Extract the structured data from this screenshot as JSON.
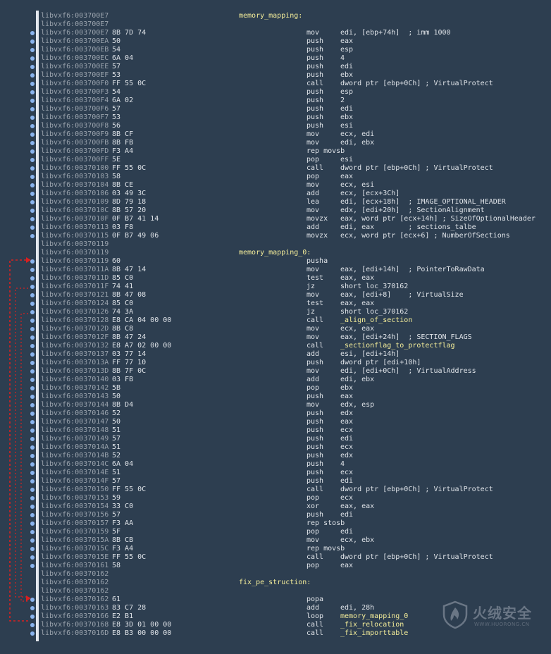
{
  "lines": [
    {
      "addr": "libvxf6:003700E7",
      "bytes": "",
      "label": "memory_mapping:",
      "mnem": "",
      "op": "",
      "dot": false
    },
    {
      "addr": "libvxf6:003700E7",
      "bytes": "",
      "label": "",
      "mnem": "",
      "op": "",
      "dot": false
    },
    {
      "addr": "libvxf6:003700E7",
      "bytes": "8B 7D 74",
      "label": "",
      "mnem": "mov",
      "op": "edi, [ebp+74h]  ; imm 1000",
      "dot": true
    },
    {
      "addr": "libvxf6:003700EA",
      "bytes": "50",
      "label": "",
      "mnem": "push",
      "op": "eax",
      "dot": true
    },
    {
      "addr": "libvxf6:003700EB",
      "bytes": "54",
      "label": "",
      "mnem": "push",
      "op": "esp",
      "dot": true
    },
    {
      "addr": "libvxf6:003700EC",
      "bytes": "6A 04",
      "label": "",
      "mnem": "push",
      "op": "4",
      "dot": true
    },
    {
      "addr": "libvxf6:003700EE",
      "bytes": "57",
      "label": "",
      "mnem": "push",
      "op": "edi",
      "dot": true
    },
    {
      "addr": "libvxf6:003700EF",
      "bytes": "53",
      "label": "",
      "mnem": "push",
      "op": "ebx",
      "dot": true
    },
    {
      "addr": "libvxf6:003700F0",
      "bytes": "FF 55 0C",
      "label": "",
      "mnem": "call",
      "op": "dword ptr [ebp+0Ch] ; VirtualProtect",
      "dot": true
    },
    {
      "addr": "libvxf6:003700F3",
      "bytes": "54",
      "label": "",
      "mnem": "push",
      "op": "esp",
      "dot": true
    },
    {
      "addr": "libvxf6:003700F4",
      "bytes": "6A 02",
      "label": "",
      "mnem": "push",
      "op": "2",
      "dot": true
    },
    {
      "addr": "libvxf6:003700F6",
      "bytes": "57",
      "label": "",
      "mnem": "push",
      "op": "edi",
      "dot": true
    },
    {
      "addr": "libvxf6:003700F7",
      "bytes": "53",
      "label": "",
      "mnem": "push",
      "op": "ebx",
      "dot": true
    },
    {
      "addr": "libvxf6:003700F8",
      "bytes": "56",
      "label": "",
      "mnem": "push",
      "op": "esi",
      "dot": true
    },
    {
      "addr": "libvxf6:003700F9",
      "bytes": "8B CF",
      "label": "",
      "mnem": "mov",
      "op": "ecx, edi",
      "dot": true
    },
    {
      "addr": "libvxf6:003700FB",
      "bytes": "8B FB",
      "label": "",
      "mnem": "mov",
      "op": "edi, ebx",
      "dot": true
    },
    {
      "addr": "libvxf6:003700FD",
      "bytes": "F3 A4",
      "label": "",
      "mnem": "rep movsb",
      "op": "",
      "dot": true
    },
    {
      "addr": "libvxf6:003700FF",
      "bytes": "5E",
      "label": "",
      "mnem": "pop",
      "op": "esi",
      "dot": true
    },
    {
      "addr": "libvxf6:00370100",
      "bytes": "FF 55 0C",
      "label": "",
      "mnem": "call",
      "op": "dword ptr [ebp+0Ch] ; VirtualProtect",
      "dot": true
    },
    {
      "addr": "libvxf6:00370103",
      "bytes": "58",
      "label": "",
      "mnem": "pop",
      "op": "eax",
      "dot": true
    },
    {
      "addr": "libvxf6:00370104",
      "bytes": "8B CE",
      "label": "",
      "mnem": "mov",
      "op": "ecx, esi",
      "dot": true
    },
    {
      "addr": "libvxf6:00370106",
      "bytes": "03 49 3C",
      "label": "",
      "mnem": "add",
      "op": "ecx, [ecx+3Ch]",
      "dot": true
    },
    {
      "addr": "libvxf6:00370109",
      "bytes": "8D 79 18",
      "label": "",
      "mnem": "lea",
      "op": "edi, [ecx+18h]  ; IMAGE_OPTIONAL_HEADER",
      "dot": true
    },
    {
      "addr": "libvxf6:0037010C",
      "bytes": "8B 57 20",
      "label": "",
      "mnem": "mov",
      "op": "edx, [edi+20h]  ; SectionAlignment",
      "dot": true
    },
    {
      "addr": "libvxf6:0037010F",
      "bytes": "0F B7 41 14",
      "label": "",
      "mnem": "movzx",
      "op": "eax, word ptr [ecx+14h] ; SizeOfOptionalHeader",
      "dot": true
    },
    {
      "addr": "libvxf6:00370113",
      "bytes": "03 F8",
      "label": "",
      "mnem": "add",
      "op": "edi, eax        ; sections_talbe",
      "dot": true
    },
    {
      "addr": "libvxf6:00370115",
      "bytes": "0F B7 49 06",
      "label": "",
      "mnem": "movzx",
      "op": "ecx, word ptr [ecx+6] ; NumberOfSections",
      "dot": true
    },
    {
      "addr": "libvxf6:00370119",
      "bytes": "",
      "label": "",
      "mnem": "",
      "op": "",
      "dot": false
    },
    {
      "addr": "libvxf6:00370119",
      "bytes": "",
      "label": "memory_mapping_0:",
      "mnem": "",
      "op": "",
      "dot": false
    },
    {
      "addr": "libvxf6:00370119",
      "bytes": "60",
      "label": "",
      "mnem": "pusha",
      "op": "",
      "dot": true
    },
    {
      "addr": "libvxf6:0037011A",
      "bytes": "8B 47 14",
      "label": "",
      "mnem": "mov",
      "op": "eax, [edi+14h]  ; PointerToRawData",
      "dot": true
    },
    {
      "addr": "libvxf6:0037011D",
      "bytes": "85 C0",
      "label": "",
      "mnem": "test",
      "op": "eax, eax",
      "dot": true
    },
    {
      "addr": "libvxf6:0037011F",
      "bytes": "74 41",
      "label": "",
      "mnem": "jz",
      "op": "short loc_370162",
      "dot": true
    },
    {
      "addr": "libvxf6:00370121",
      "bytes": "8B 47 08",
      "label": "",
      "mnem": "mov",
      "op": "eax, [edi+8]    ; VirtualSize",
      "dot": true
    },
    {
      "addr": "libvxf6:00370124",
      "bytes": "85 C0",
      "label": "",
      "mnem": "test",
      "op": "eax, eax",
      "dot": true
    },
    {
      "addr": "libvxf6:00370126",
      "bytes": "74 3A",
      "label": "",
      "mnem": "jz",
      "op": "short loc_370162",
      "dot": true
    },
    {
      "addr": "libvxf6:00370128",
      "bytes": "E8 CA 04 00 00",
      "label": "",
      "mnem": "call",
      "op": "_align_of_section",
      "ref": true,
      "dot": true
    },
    {
      "addr": "libvxf6:0037012D",
      "bytes": "8B C8",
      "label": "",
      "mnem": "mov",
      "op": "ecx, eax",
      "dot": true
    },
    {
      "addr": "libvxf6:0037012F",
      "bytes": "8B 47 24",
      "label": "",
      "mnem": "mov",
      "op": "eax, [edi+24h]  ; SECTION_FLAGS",
      "dot": true
    },
    {
      "addr": "libvxf6:00370132",
      "bytes": "E8 A7 02 00 00",
      "label": "",
      "mnem": "call",
      "op": "_sectionflag_to_protectflag",
      "ref": true,
      "dot": true
    },
    {
      "addr": "libvxf6:00370137",
      "bytes": "03 77 14",
      "label": "",
      "mnem": "add",
      "op": "esi, [edi+14h]",
      "dot": true
    },
    {
      "addr": "libvxf6:0037013A",
      "bytes": "FF 77 10",
      "label": "",
      "mnem": "push",
      "op": "dword ptr [edi+10h]",
      "dot": true
    },
    {
      "addr": "libvxf6:0037013D",
      "bytes": "8B 7F 0C",
      "label": "",
      "mnem": "mov",
      "op": "edi, [edi+0Ch]  ; VirtualAddress",
      "dot": true
    },
    {
      "addr": "libvxf6:00370140",
      "bytes": "03 FB",
      "label": "",
      "mnem": "add",
      "op": "edi, ebx",
      "dot": true
    },
    {
      "addr": "libvxf6:00370142",
      "bytes": "5B",
      "label": "",
      "mnem": "pop",
      "op": "ebx",
      "dot": true
    },
    {
      "addr": "libvxf6:00370143",
      "bytes": "50",
      "label": "",
      "mnem": "push",
      "op": "eax",
      "dot": true
    },
    {
      "addr": "libvxf6:00370144",
      "bytes": "8B D4",
      "label": "",
      "mnem": "mov",
      "op": "edx, esp",
      "dot": true
    },
    {
      "addr": "libvxf6:00370146",
      "bytes": "52",
      "label": "",
      "mnem": "push",
      "op": "edx",
      "dot": true
    },
    {
      "addr": "libvxf6:00370147",
      "bytes": "50",
      "label": "",
      "mnem": "push",
      "op": "eax",
      "dot": true
    },
    {
      "addr": "libvxf6:00370148",
      "bytes": "51",
      "label": "",
      "mnem": "push",
      "op": "ecx",
      "dot": true
    },
    {
      "addr": "libvxf6:00370149",
      "bytes": "57",
      "label": "",
      "mnem": "push",
      "op": "edi",
      "dot": true
    },
    {
      "addr": "libvxf6:0037014A",
      "bytes": "51",
      "label": "",
      "mnem": "push",
      "op": "ecx",
      "dot": true
    },
    {
      "addr": "libvxf6:0037014B",
      "bytes": "52",
      "label": "",
      "mnem": "push",
      "op": "edx",
      "dot": true
    },
    {
      "addr": "libvxf6:0037014C",
      "bytes": "6A 04",
      "label": "",
      "mnem": "push",
      "op": "4",
      "dot": true
    },
    {
      "addr": "libvxf6:0037014E",
      "bytes": "51",
      "label": "",
      "mnem": "push",
      "op": "ecx",
      "dot": true
    },
    {
      "addr": "libvxf6:0037014F",
      "bytes": "57",
      "label": "",
      "mnem": "push",
      "op": "edi",
      "dot": true
    },
    {
      "addr": "libvxf6:00370150",
      "bytes": "FF 55 0C",
      "label": "",
      "mnem": "call",
      "op": "dword ptr [ebp+0Ch] ; VirtualProtect",
      "dot": true
    },
    {
      "addr": "libvxf6:00370153",
      "bytes": "59",
      "label": "",
      "mnem": "pop",
      "op": "ecx",
      "dot": true
    },
    {
      "addr": "libvxf6:00370154",
      "bytes": "33 C0",
      "label": "",
      "mnem": "xor",
      "op": "eax, eax",
      "dot": true
    },
    {
      "addr": "libvxf6:00370156",
      "bytes": "57",
      "label": "",
      "mnem": "push",
      "op": "edi",
      "dot": true
    },
    {
      "addr": "libvxf6:00370157",
      "bytes": "F3 AA",
      "label": "",
      "mnem": "rep stosb",
      "op": "",
      "dot": true
    },
    {
      "addr": "libvxf6:00370159",
      "bytes": "5F",
      "label": "",
      "mnem": "pop",
      "op": "edi",
      "dot": true
    },
    {
      "addr": "libvxf6:0037015A",
      "bytes": "8B CB",
      "label": "",
      "mnem": "mov",
      "op": "ecx, ebx",
      "dot": true
    },
    {
      "addr": "libvxf6:0037015C",
      "bytes": "F3 A4",
      "label": "",
      "mnem": "rep movsb",
      "op": "",
      "dot": true
    },
    {
      "addr": "libvxf6:0037015E",
      "bytes": "FF 55 0C",
      "label": "",
      "mnem": "call",
      "op": "dword ptr [ebp+0Ch] ; VirtualProtect",
      "dot": true
    },
    {
      "addr": "libvxf6:00370161",
      "bytes": "58",
      "label": "",
      "mnem": "pop",
      "op": "eax",
      "dot": true
    },
    {
      "addr": "libvxf6:00370162",
      "bytes": "",
      "label": "",
      "mnem": "",
      "op": "",
      "dot": false
    },
    {
      "addr": "libvxf6:00370162",
      "bytes": "",
      "label": "fix_pe_struction:",
      "mnem": "",
      "op": "",
      "dot": false
    },
    {
      "addr": "libvxf6:00370162",
      "bytes": "",
      "label": "",
      "mnem": "",
      "op": "",
      "dot": false
    },
    {
      "addr": "libvxf6:00370162",
      "bytes": "61",
      "label": "",
      "mnem": "popa",
      "op": "",
      "dot": true
    },
    {
      "addr": "libvxf6:00370163",
      "bytes": "83 C7 28",
      "label": "",
      "mnem": "add",
      "op": "edi, 28h",
      "dot": true
    },
    {
      "addr": "libvxf6:00370166",
      "bytes": "E2 B1",
      "label": "",
      "mnem": "loop",
      "op": "memory_mapping_0",
      "ref": true,
      "dot": true
    },
    {
      "addr": "libvxf6:00370168",
      "bytes": "E8 3D 01 00 00",
      "label": "",
      "mnem": "call",
      "op": "_fix_relocation",
      "ref": true,
      "dot": true
    },
    {
      "addr": "libvxf6:0037016D",
      "bytes": "E8 B3 00 00 00",
      "label": "",
      "mnem": "call",
      "op": "_fix_importtable",
      "ref": true,
      "dot": true
    }
  ],
  "watermark": {
    "name": "火绒安全",
    "site": "WWW.HUORONG.CN"
  },
  "colors": {
    "background": "#2d3e50",
    "label": "#f5ee9a",
    "arrow": "#d82020",
    "dot": "#8ab4ee"
  }
}
